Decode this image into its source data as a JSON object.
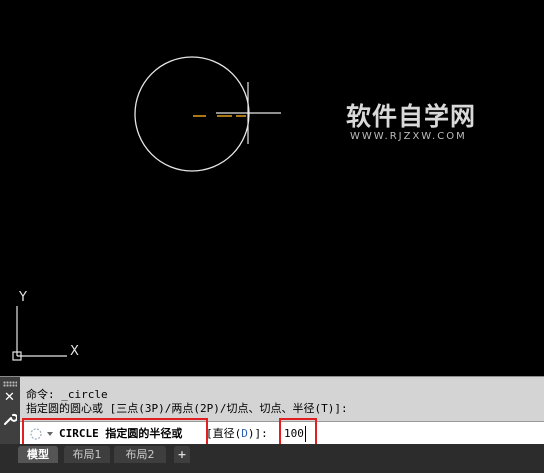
{
  "canvas": {
    "watermark_cn": "软件自学网",
    "watermark_url": "WWW.RJZXW.COM",
    "ucs_x": "X",
    "ucs_y": "Y",
    "colors": {
      "background": "#000000",
      "circle": "#e6e6e6",
      "snap_track": "#e3a11c",
      "crosshair": "#e6e6e6"
    }
  },
  "command": {
    "history_line1": "命令: _circle",
    "history_line2": "指定圆的圆心或 [三点(3P)/两点(2P)/切点、切点、半径(T)]:",
    "prompt": "CIRCLE 指定圆的半径或",
    "option_open": "[直径(",
    "option_key": "D",
    "option_close": ")]:",
    "input_value": "100",
    "close_icon": "close-icon",
    "customize_icon": "wrench-icon"
  },
  "tabs": [
    {
      "label": "模型",
      "active": true
    },
    {
      "label": "布局1",
      "active": false
    },
    {
      "label": "布局2",
      "active": false
    },
    {
      "label": "+",
      "active": false
    }
  ],
  "annotation_color": "#e02020"
}
